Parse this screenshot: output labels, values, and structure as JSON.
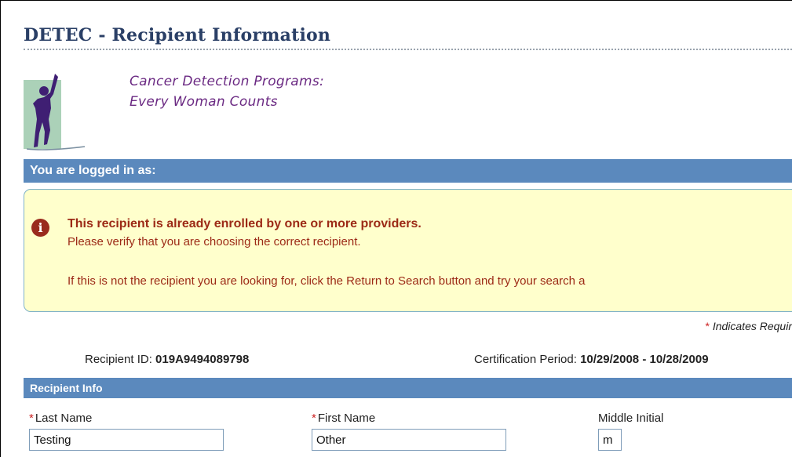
{
  "header": {
    "page_title": "DETEC - Recipient Information",
    "program_line1": "Cancer Detection Programs:",
    "program_line2": "Every Woman Counts"
  },
  "session": {
    "logged_in_label": "You are logged in as:"
  },
  "alert": {
    "icon": "info-icon",
    "heading": "This recipient is already enrolled by one or more providers.",
    "line1": "Please verify that you are choosing the correct recipient.",
    "line2": "If this is not the recipient you are looking for, click the Return to Search button and try your search a"
  },
  "required_note": {
    "star": "*",
    "text": "Indicates Requir"
  },
  "recipient": {
    "id_label": "Recipient ID:",
    "id_value": "019A9494089798",
    "cert_label": "Certification Period:",
    "cert_value": "10/29/2008 - 10/28/2009"
  },
  "recipient_info": {
    "section_title": "Recipient Info",
    "last_name_label": "Last Name",
    "last_name_value": "Testing",
    "first_name_label": "First Name",
    "first_name_value": "Other",
    "middle_initial_label": "Middle Initial",
    "middle_initial_value": "m",
    "required_star": "*"
  },
  "colors": {
    "bar_blue": "#5b89bd",
    "title_navy": "#2a3f66",
    "alert_red": "#9c2a16",
    "alert_bg": "#ffffcc",
    "program_purple": "#6b2a83"
  }
}
